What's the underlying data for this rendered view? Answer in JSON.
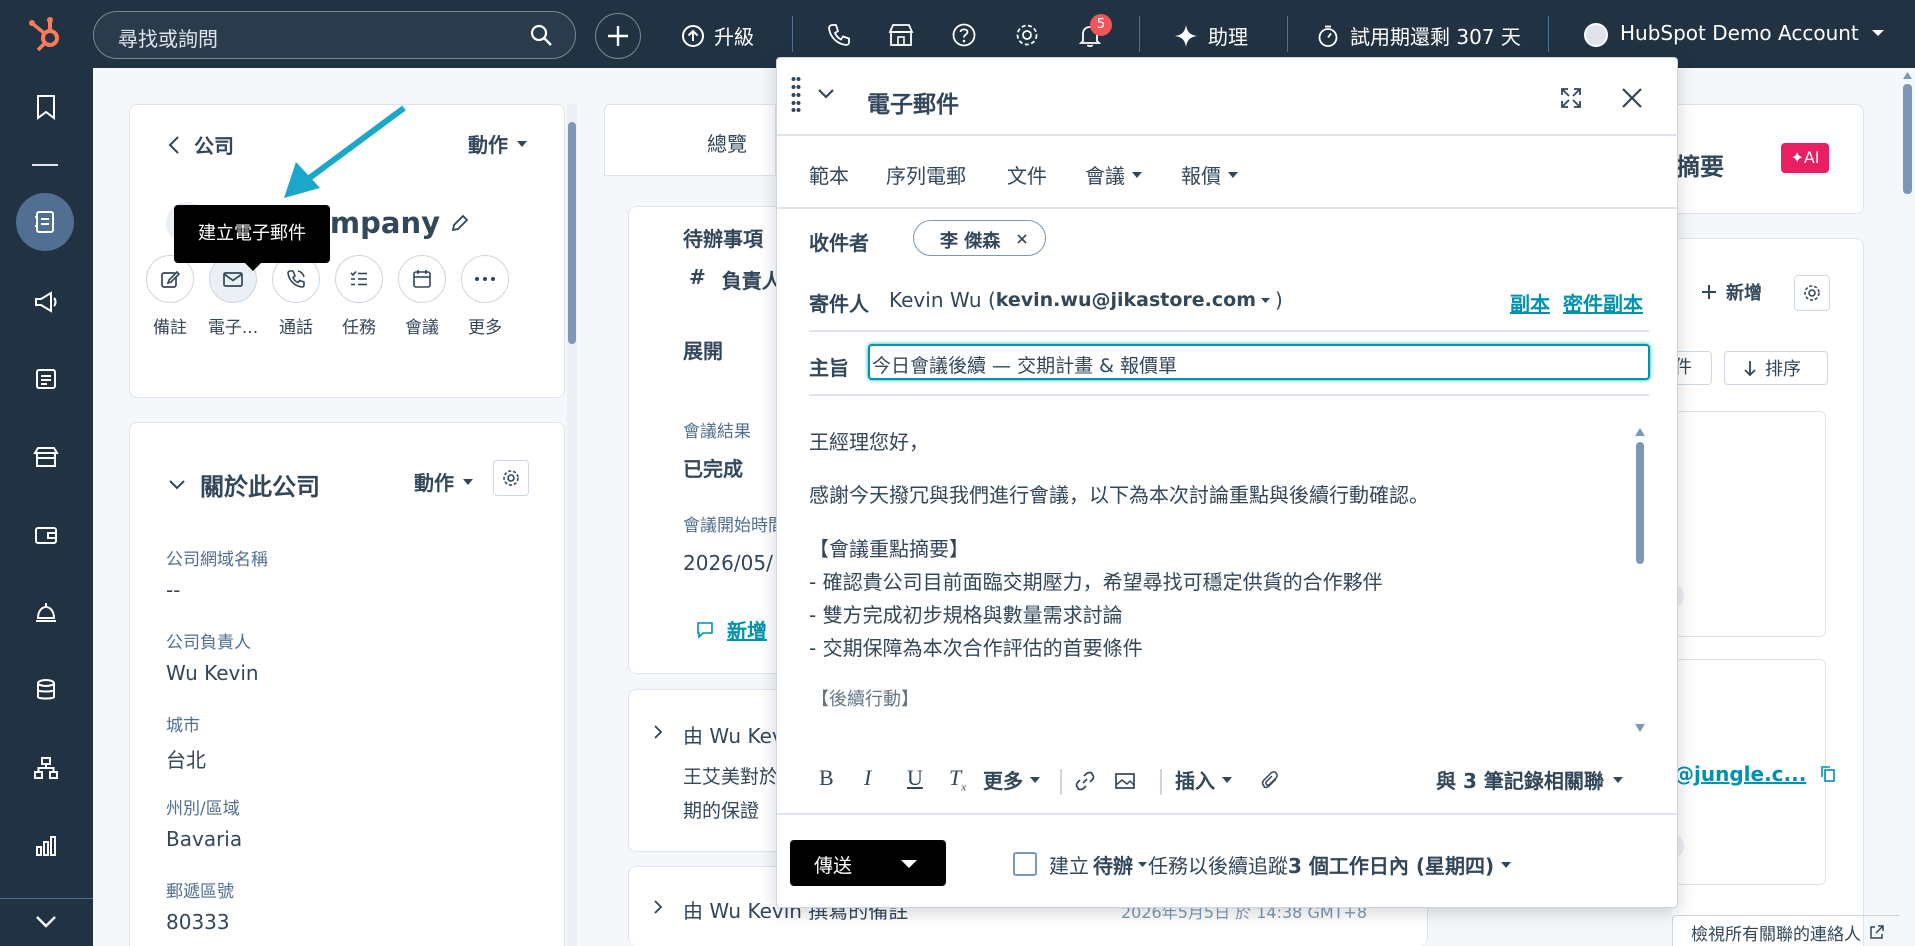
{
  "topbar": {
    "search_placeholder": "尋找或詢問",
    "upgrade_label": "升級",
    "notifications_count": "5",
    "assistant_label": "助理",
    "trial_label": "試用期還剩 307 天",
    "account_name": "HubSpot Demo Account"
  },
  "company_card": {
    "back_label": "公司",
    "actions_label": "動作",
    "company_name_partial": "ompany",
    "tooltip": "建立電子郵件",
    "action_buttons": [
      "備註",
      "電子...",
      "通話",
      "任務",
      "會議",
      "更多"
    ]
  },
  "about_card": {
    "title": "關於此公司",
    "actions_label": "動作",
    "properties": [
      {
        "label": "公司網域名稱",
        "value": "--"
      },
      {
        "label": "公司負責人",
        "value": "Wu Kevin"
      },
      {
        "label": "城市",
        "value": "台北"
      },
      {
        "label": "州別/區域",
        "value": "Bavaria"
      },
      {
        "label": "郵遞區號",
        "value": "80333"
      }
    ]
  },
  "middle": {
    "tab_overview": "總覽",
    "todo_label": "待辦事項",
    "owner_hash": "#",
    "owner_label": "負責人",
    "expand_label": "展開",
    "meeting_result_label": "會議結果",
    "meeting_result_value": "已完成",
    "meeting_start_label": "會議開始時間",
    "meeting_start_value": "2026/05/",
    "add_comment_label": "新增",
    "activity1_header": "由 Wu Kev",
    "activity1_line1": "王艾美對於",
    "activity1_line2": "期的保證",
    "activity2_header": "由 Wu Kevin 撰寫的備註",
    "activity2_date": "2026年5月5日 於 14:38 GMT+8"
  },
  "right": {
    "summary_label": "摘要",
    "ai_badge": "✦AI",
    "add_label": "新增",
    "filter_partial": "件",
    "sort_label": "排序",
    "email_partial": "@jungle.c...",
    "view_all_contacts": "檢視所有關聯的連絡人"
  },
  "email_modal": {
    "title": "電子郵件",
    "toolbar": [
      "範本",
      "序列電郵",
      "文件",
      "會議",
      "報價"
    ],
    "to_label": "收件者",
    "recipient_chip": "李 傑森",
    "from_label": "寄件人",
    "from_name": "Kevin Wu (",
    "from_email": "kevin.wu@jikastore.com",
    "from_close": ")",
    "cc_label": "副本",
    "bcc_label": "密件副本",
    "subject_label": "主旨",
    "subject_value": "今日會議後續 — 交期計畫 & 報價單",
    "body_lines": [
      "王經理您好，",
      "感謝今天撥冗與我們進行會議，以下為本次討論重點與後續行動確認。",
      "【會議重點摘要】",
      "- 確認貴公司目前面臨交期壓力，希望尋找可穩定供貨的合作夥伴",
      "- 雙方完成初步規格與數量需求討論",
      "- 交期保障為本次合作評估的首要條件",
      "【後續行動】"
    ],
    "format_more": "更多",
    "insert_label": "插入",
    "associated_label": "與 3 筆記錄相關聯",
    "send_label": "傳送",
    "followup_prefix": "建立",
    "followup_todo": "待辦",
    "followup_middle": "任務以後續追蹤",
    "followup_when": "3 個工作日內 (星期四)"
  },
  "colors": {
    "nav_bg": "#213343",
    "accent_teal": "#0091ae",
    "arrow_cyan": "#1aa7c9",
    "ai_pink": "#e91e63"
  }
}
